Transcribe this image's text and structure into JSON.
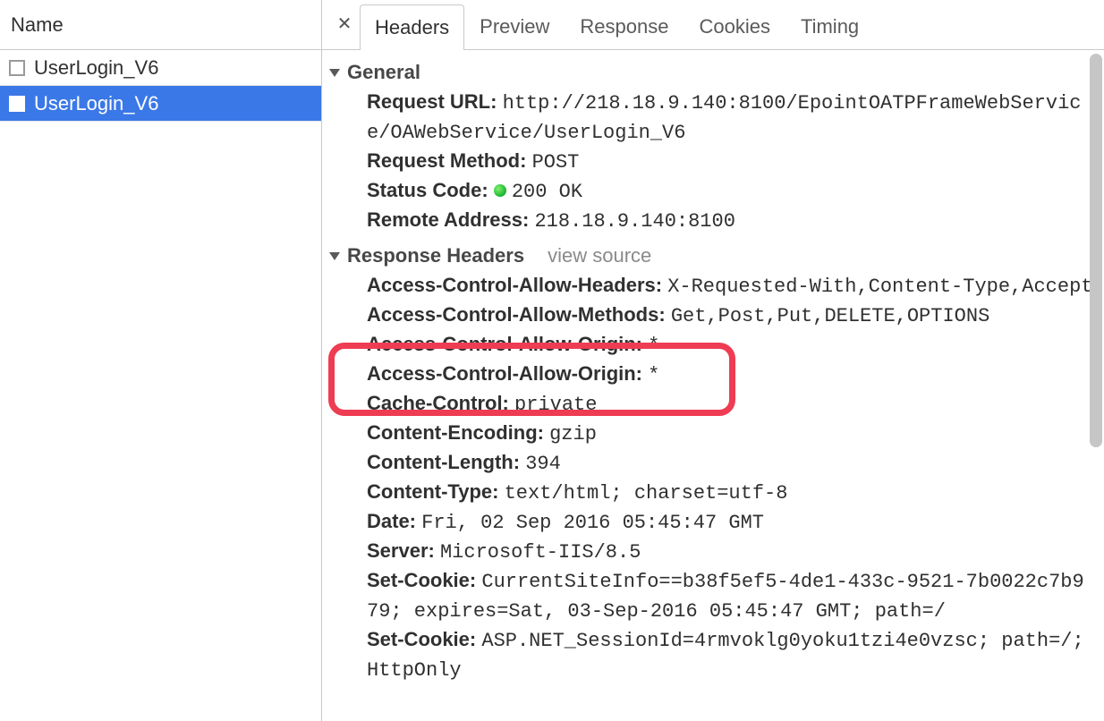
{
  "sidebar": {
    "header": "Name",
    "items": [
      {
        "label": "UserLogin_V6",
        "selected": false
      },
      {
        "label": "UserLogin_V6",
        "selected": true
      }
    ]
  },
  "tabs": {
    "close_glyph": "✕",
    "items": [
      {
        "label": "Headers",
        "active": true
      },
      {
        "label": "Preview",
        "active": false
      },
      {
        "label": "Response",
        "active": false
      },
      {
        "label": "Cookies",
        "active": false
      },
      {
        "label": "Timing",
        "active": false
      }
    ]
  },
  "general": {
    "title": "General",
    "request_url": {
      "label": "Request URL:",
      "value": "http://218.18.9.140:8100/EpointOATPFrameWebService/OAWebService/UserLogin_V6"
    },
    "request_method": {
      "label": "Request Method:",
      "value": "POST"
    },
    "status_code": {
      "label": "Status Code:",
      "value": "200 OK"
    },
    "remote_address": {
      "label": "Remote Address:",
      "value": "218.18.9.140:8100"
    }
  },
  "response_headers": {
    "title": "Response Headers",
    "view_source": "view source",
    "items": [
      {
        "label": "Access-Control-Allow-Headers:",
        "value": "X-Requested-With,Content-Type,Accept"
      },
      {
        "label": "Access-Control-Allow-Methods:",
        "value": "Get,Post,Put,DELETE,OPTIONS"
      },
      {
        "label": "Access-Control-Allow-Origin:",
        "value": "*"
      },
      {
        "label": "Access-Control-Allow-Origin:",
        "value": "*"
      },
      {
        "label": "Cache-Control:",
        "value": "private"
      },
      {
        "label": "Content-Encoding:",
        "value": "gzip"
      },
      {
        "label": "Content-Length:",
        "value": "394"
      },
      {
        "label": "Content-Type:",
        "value": "text/html; charset=utf-8"
      },
      {
        "label": "Date:",
        "value": "Fri, 02 Sep 2016 05:45:47 GMT"
      },
      {
        "label": "Server:",
        "value": "Microsoft-IIS/8.5"
      },
      {
        "label": "Set-Cookie:",
        "value": "CurrentSiteInfo==b38f5ef5-4de1-433c-9521-7b0022c7b979; expires=Sat, 03-Sep-2016 05:45:47 GMT; path=/"
      },
      {
        "label": "Set-Cookie:",
        "value": "ASP.NET_SessionId=4rmvoklg0yoku1tzi4e0vzsc; path=/; HttpOnly"
      }
    ]
  }
}
